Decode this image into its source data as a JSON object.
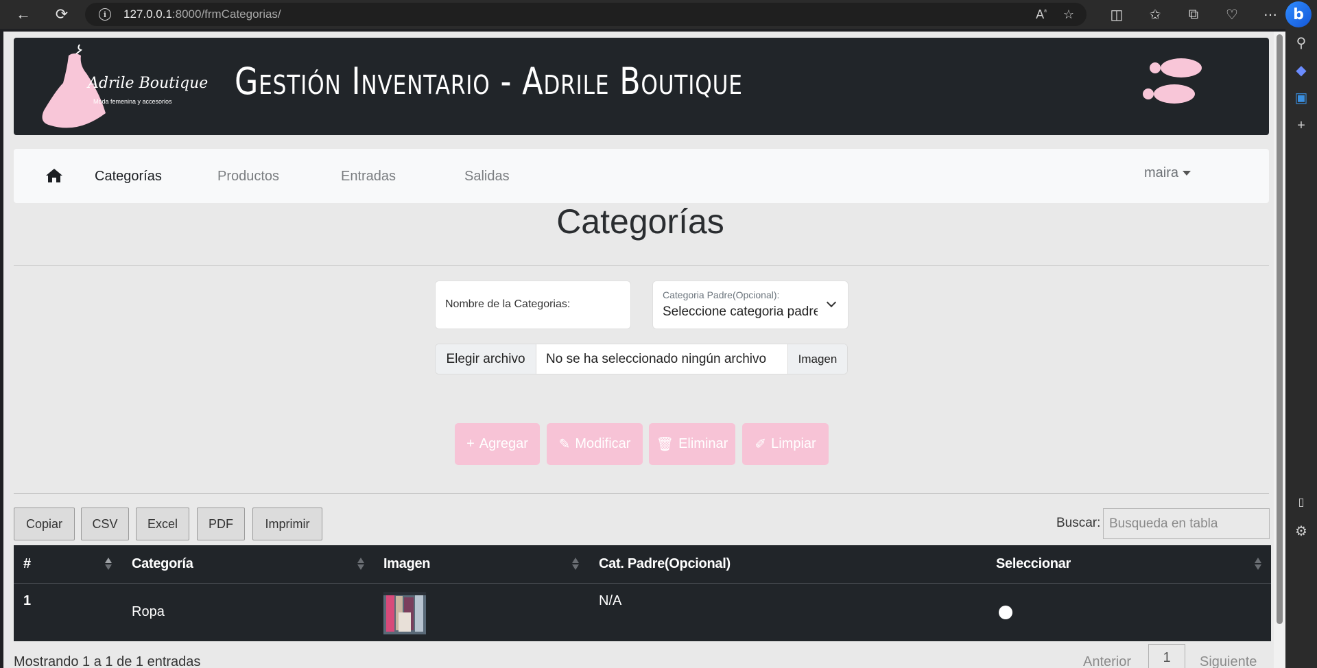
{
  "browser": {
    "url_host": "127.0.0.1",
    "url_path": ":8000/frmCategorias/"
  },
  "header": {
    "logo_name": "Adrile Boutique",
    "logo_tagline": "Moda femenina y accesorios",
    "title": "Gestión Inventario - Adrile Boutique",
    "accent_color": "#f8c6d8"
  },
  "nav": {
    "items": [
      {
        "label": "Categorías",
        "active": true
      },
      {
        "label": "Productos"
      },
      {
        "label": "Entradas"
      },
      {
        "label": "Salidas"
      }
    ],
    "user": "maira"
  },
  "page": {
    "title": "Categorías"
  },
  "form": {
    "name_label": "Nombre de la Categorias:",
    "parent_label": "Categoria Padre(Opcional):",
    "parent_value": "Seleccione categoria padre",
    "file_button": "Elegir archivo",
    "file_status": "No se ha seleccionado ningún archivo",
    "file_suffix": "Imagen"
  },
  "actions": {
    "add": "Agregar",
    "modify": "Modificar",
    "delete": "Eliminar",
    "clear": "Limpiar",
    "button_color": "#f7c3d6"
  },
  "export": {
    "copy": "Copiar",
    "csv": "CSV",
    "excel": "Excel",
    "pdf": "PDF",
    "print": "Imprimir"
  },
  "search": {
    "label": "Buscar:",
    "placeholder": "Busqueda en tabla"
  },
  "table": {
    "columns": [
      "#",
      "Categoría",
      "Imagen",
      "Cat. Padre(Opcional)",
      "Seleccionar"
    ],
    "rows": [
      {
        "id": "1",
        "category": "Ropa",
        "parent": "N/A"
      }
    ]
  },
  "footer": {
    "info": "Mostrando 1 a 1 de 1 entradas",
    "prev": "Anterior",
    "page": "1",
    "next": "Siguiente"
  }
}
